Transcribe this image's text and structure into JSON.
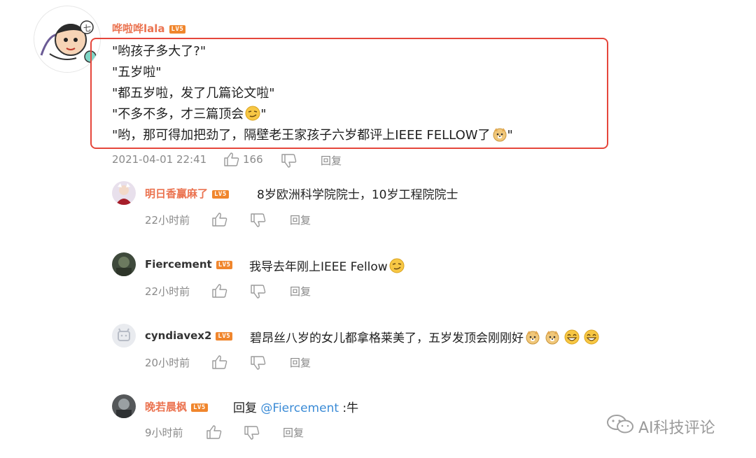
{
  "main_comment": {
    "username": "哗啦哗lala",
    "level": "LV5",
    "lines": [
      "\"哟孩子多大了?\"",
      "\"五岁啦\"",
      "\"都五岁啦，发了几篇论文啦\"",
      "\"不多不多，才三篇顶会",
      "\"哟，那可得加把劲了，隔壁老王家孩子六岁都评上IEEE FELLOW了"
    ],
    "line_end_quote": "\"",
    "timestamp": "2021-04-01 22:41",
    "likes": "166",
    "reply_label": "回复"
  },
  "replies": [
    {
      "username": "明日香赢麻了",
      "level": "LV5",
      "text": "8岁欧洲科学院院士，10岁工程院院士",
      "time": "22小时前",
      "reply_label": "回复"
    },
    {
      "username": "Fiercement",
      "level": "LV5",
      "text": "我导去年刚上IEEE Fellow",
      "time": "22小时前",
      "reply_label": "回复"
    },
    {
      "username": "cyndiavex2",
      "level": "LV5",
      "text": "碧昂丝八岁的女儿都拿格莱美了，五岁发顶会刚刚好",
      "time": "20小时前",
      "reply_label": "回复"
    },
    {
      "username": "晚若晨枫",
      "level": "LV5",
      "text_prefix": "回复 ",
      "mention": "@Fiercement",
      "text_suffix": " :牛",
      "time": "9小时前",
      "reply_label": "回复"
    }
  ],
  "watermark": "AI科技评论",
  "icons": [
    "thumbs-up-icon",
    "thumbs-down-icon",
    "smirk-emoji-icon",
    "doge-emoji-icon",
    "grin-emoji-icon",
    "wechat-icon"
  ],
  "colors": {
    "username_pink": "#eb7350",
    "highlight_red": "#e5463b",
    "level_orange": "#f0862d",
    "mention_blue": "#3b8bd6",
    "meta_gray": "#8a8a8a"
  }
}
